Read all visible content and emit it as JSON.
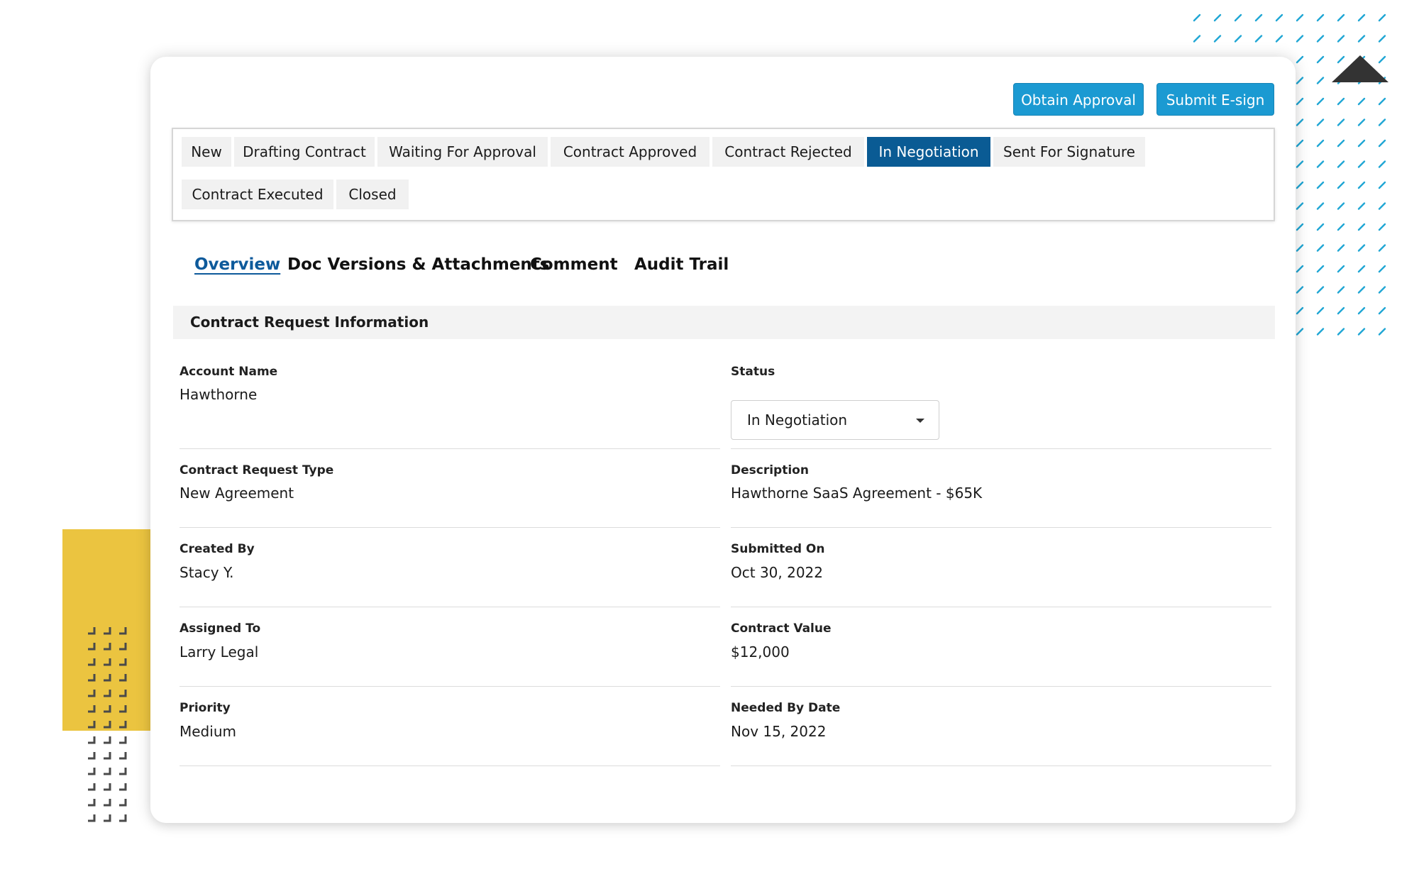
{
  "actions": {
    "obtain_approval": "Obtain Approval",
    "submit_esign": "Submit E-sign"
  },
  "stages": [
    {
      "label": "New",
      "active": false
    },
    {
      "label": "Drafting Contract",
      "active": false
    },
    {
      "label": "Waiting For Approval",
      "active": false
    },
    {
      "label": "Contract Approved",
      "active": false
    },
    {
      "label": "Contract Rejected",
      "active": false
    },
    {
      "label": "In Negotiation",
      "active": true
    },
    {
      "label": "Sent For Signature",
      "active": false
    },
    {
      "label": "Contract Executed",
      "active": false
    },
    {
      "label": "Closed",
      "active": false
    }
  ],
  "tabs": [
    {
      "label": "Overview",
      "active": true
    },
    {
      "label": "Doc Versions & Attachments",
      "active": false
    },
    {
      "label": "Comment",
      "active": false
    },
    {
      "label": "Audit Trail",
      "active": false
    }
  ],
  "section": {
    "title": "Contract Request Information"
  },
  "fields": {
    "account_name": {
      "label": "Account Name",
      "value": "Hawthorne"
    },
    "status": {
      "label": "Status",
      "value": "In Negotiation"
    },
    "request_type": {
      "label": "Contract Request Type",
      "value": "New Agreement"
    },
    "description": {
      "label": "Description",
      "value": "Hawthorne SaaS Agreement - $65K"
    },
    "created_by": {
      "label": "Created By",
      "value": "Stacy Y."
    },
    "submitted_on": {
      "label": "Submitted On",
      "value": "Oct 30, 2022"
    },
    "assigned_to": {
      "label": "Assigned To",
      "value": "Larry Legal"
    },
    "contract_value": {
      "label": "Contract Value",
      "value": "$12,000"
    },
    "priority": {
      "label": "Priority",
      "value": "Medium"
    },
    "needed_by": {
      "label": "Needed By Date",
      "value": "Nov 15, 2022"
    }
  },
  "colors": {
    "accent_button": "#1b9ad2",
    "active_stage": "#0a5b94",
    "active_tab": "#0d5a9b",
    "deco_yellow": "#ebc440",
    "deco_cyan": "#1fa6d4"
  },
  "icons": {
    "status_dropdown": "caret-down-icon"
  }
}
